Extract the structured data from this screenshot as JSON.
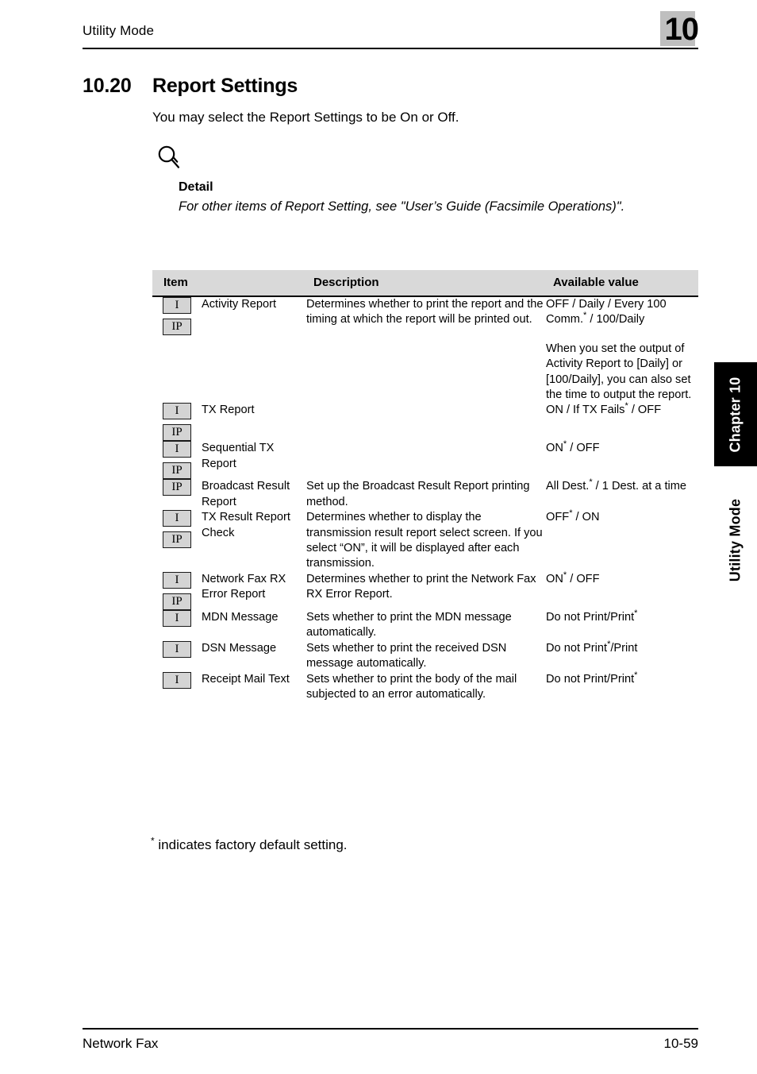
{
  "header": {
    "running_head": "Utility Mode",
    "chapter_number": "10"
  },
  "section": {
    "number": "10.20",
    "title": "Report Settings",
    "intro": "You may select the Report Settings to be On or Off."
  },
  "note": {
    "icon": "magnifier-icon",
    "title": "Detail",
    "text": "For other items of Report Setting, see \"User’s Guide (Facsimile Operations)\"."
  },
  "table": {
    "columns": [
      "Item",
      "Description",
      "Available value"
    ],
    "rows": [
      {
        "badges": [
          "I",
          "IP"
        ],
        "name": "Activity Report",
        "description": "Determines whether to print the report and the timing at which the report will be printed out.",
        "value_1": "OFF / Daily / Every 100 Comm.",
        "value_1_star": "*",
        "value_1_tail": " / 100/Daily",
        "value_2": "When you set the output of Activity Report to [Daily] or [100/Daily], you can also set the time to output the report."
      },
      {
        "badges": [
          "I",
          "IP"
        ],
        "name": "TX Report",
        "description": "",
        "value_1": "ON / If TX Fails",
        "value_1_star": "*",
        "value_1_tail": " / OFF",
        "value_2": ""
      },
      {
        "badges": [
          "I",
          "IP"
        ],
        "name": "Sequential TX Report",
        "description": "",
        "value_1": "ON",
        "value_1_star": "*",
        "value_1_tail": " / OFF",
        "value_2": ""
      },
      {
        "badges": [
          "IP"
        ],
        "name": "Broadcast Result Report",
        "description": "Set up the Broadcast Result Report printing method.",
        "value_1": "All Dest.",
        "value_1_star": "*",
        "value_1_tail": " / 1 Dest. at a time",
        "value_2": ""
      },
      {
        "badges": [
          "I",
          "IP"
        ],
        "name": "TX Result Report Check",
        "description": "Determines whether to display the transmission result report select screen. If you select “ON”, it will be displayed after each transmission.",
        "value_1": "OFF",
        "value_1_star": "*",
        "value_1_tail": " / ON",
        "value_2": ""
      },
      {
        "badges": [
          "I",
          "IP"
        ],
        "name": "Network Fax RX Error Report",
        "description": "Determines whether to print the Network Fax RX Error Report.",
        "value_1": "ON",
        "value_1_star": "*",
        "value_1_tail": " / OFF",
        "value_2": ""
      },
      {
        "badges": [
          "I"
        ],
        "name": "MDN Message",
        "description": "Sets whether to print the MDN message automatically.",
        "value_1": "Do not Print/Print",
        "value_1_star": "*",
        "value_1_tail": "",
        "value_2": ""
      },
      {
        "badges": [
          "I"
        ],
        "name": "DSN Message",
        "description": "Sets whether to print the received DSN message automatically.",
        "value_1": "Do not Print",
        "value_1_star": "*",
        "value_1_tail": "/Print",
        "value_2": ""
      },
      {
        "badges": [
          "I"
        ],
        "name": "Receipt Mail Text",
        "description": "Sets whether to print the body of the mail subjected to an error automatically.",
        "value_1": "Do not Print/Print",
        "value_1_star": "*",
        "value_1_tail": "",
        "value_2": ""
      }
    ]
  },
  "footnote": {
    "star": "*",
    "text": " indicates factory default setting."
  },
  "side_tabs": {
    "chapter": "Chapter 10",
    "section": "Utility Mode"
  },
  "footer": {
    "left": "Network Fax",
    "right": "10-59"
  }
}
